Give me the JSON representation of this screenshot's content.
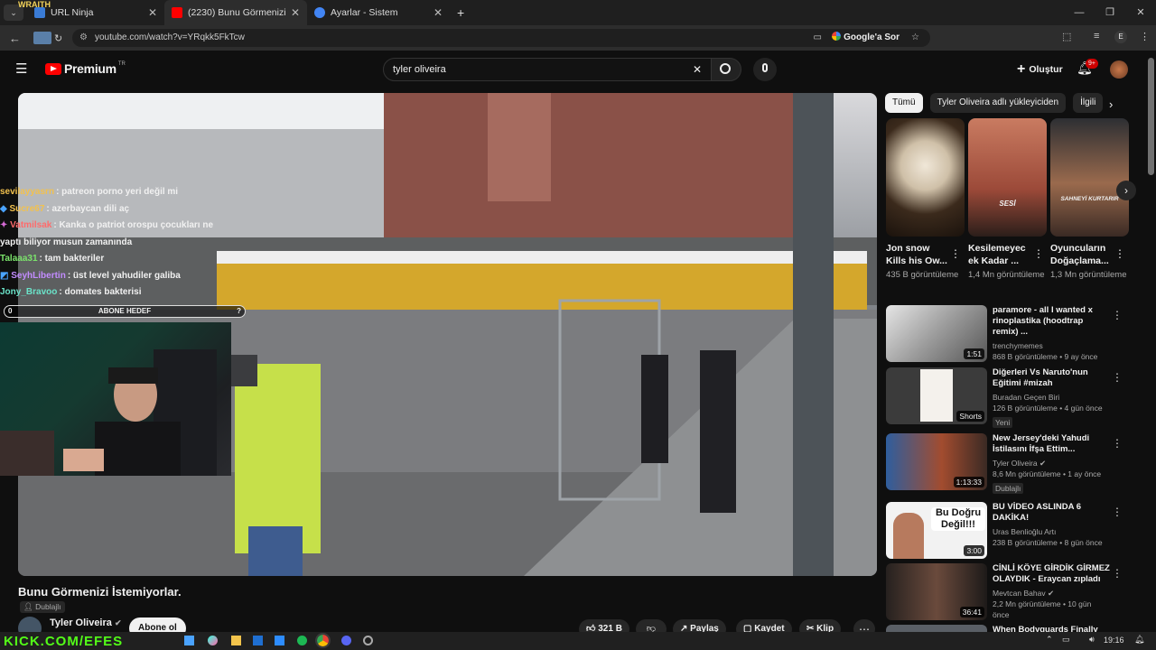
{
  "browser": {
    "tabs": [
      {
        "label": "URL Ninja",
        "color": "#3a7bd5"
      },
      {
        "label": "(2230) Bunu Görmenizi İstemiyo",
        "color": "#ff0000"
      },
      {
        "label": "Ayarlar - Sistem",
        "color": "#4285f4"
      }
    ],
    "url": "youtube.com/watch?v=YRqkk5FkTcw",
    "ask_label": "Google'a Sor",
    "profile_initial": "E"
  },
  "youtube": {
    "premium_label": "Premium",
    "tr_label": "TR",
    "search_value": "tyler oliveira",
    "create_label": "Oluştur",
    "notif_badge": "9+"
  },
  "overlay": {
    "wraith_label": "WRAITH",
    "goal_label": "ABONE HEDEF",
    "goal_current": "0",
    "goal_target": "?",
    "watermark": "KICK.COM/EFES",
    "chat": [
      {
        "name": "sevilayyasrn",
        "text": "patreon porno yeri değil mi",
        "color": "#f2c14e"
      },
      {
        "name": "Sucre67",
        "text": "azerbaycan dili aç",
        "color": "#f2c14e"
      },
      {
        "name": "Vatmilsak",
        "text": "Kanka o patriot orospu çocukları ne yaptı biliyor musun zamanında",
        "color": "#ff6b6b"
      },
      {
        "name": "Talaaa31",
        "text": "tam bakteriler",
        "color": "#7be36b"
      },
      {
        "name": "SeyhLibertin",
        "text": "üst level yahudiler galiba",
        "color": "#c38cff"
      },
      {
        "name": "Jony_Bravoo",
        "text": "domates bakterisi",
        "color": "#6be3c9"
      }
    ]
  },
  "video": {
    "title": "Bunu Görmenizi İstemiyorlar.",
    "dubbed_label": "Dublajlı",
    "channel": "Tyler Oliveira",
    "subscribe_label": "Abone ol",
    "likes": "321 B",
    "share_label": "Paylaş",
    "save_label": "Kaydet",
    "clip_label": "Klip"
  },
  "chips": [
    "Tümü",
    "Tyler Oliveira adlı yükleyiciden",
    "İlgili"
  ],
  "shorts": [
    {
      "title": "Jon snow Kills his Ow...",
      "views": "435 B görüntüleme",
      "caption": ""
    },
    {
      "title": "Kesilemeyec ek Kadar ...",
      "views": "1,4 Mn görüntüleme",
      "caption": "SESİ"
    },
    {
      "title": "Oyuncuların Doğaçlama...",
      "views": "1,3 Mn görüntüleme",
      "caption": "SAHNEYİ KURTARIR"
    }
  ],
  "recommendations": [
    {
      "title": "paramore - all I wanted x rinoplastika (hoodtrap remix) ...",
      "channel": "trenchymemes",
      "meta": "868 B görüntüleme • 9 ay önce",
      "duration": "1:51",
      "extra": ""
    },
    {
      "title": "Diğerleri Vs Naruto'nun Eğitimi #mizah",
      "channel": "Buradan Geçen Biri",
      "meta": "126 B görüntüleme • 4 gün önce",
      "duration": "Shorts",
      "extra": "Yeni"
    },
    {
      "title": "New Jersey'deki Yahudi İstilasını İfşa Ettim...",
      "channel": "Tyler Oliveira",
      "meta": "8,6 Mn görüntüleme • 1 ay önce",
      "duration": "1:13:33",
      "extra": "Dublajlı"
    },
    {
      "title": "BU VİDEO ASLINDA 6 DAKİKA!",
      "channel": "Uras Benlioğlu Artı",
      "meta": "238 B görüntüleme • 8 gün önce",
      "duration": "3:00",
      "extra": "",
      "thumb_text": "Bu Doğru Değil!!!"
    },
    {
      "title": "CİNLİ KÖYE GİRDİK GİRMEZ OLAYDIK - Eraycan zıpladı",
      "channel": "Mevtcan Bahav",
      "meta": "2,2 Mn görüntüleme • 10 gün önce",
      "duration": "36:41",
      "extra": ""
    },
    {
      "title": "When Bodyguards Finally Fight",
      "channel": "",
      "meta": "",
      "duration": "",
      "extra": ""
    }
  ],
  "taskbar": {
    "time": "19:16"
  }
}
